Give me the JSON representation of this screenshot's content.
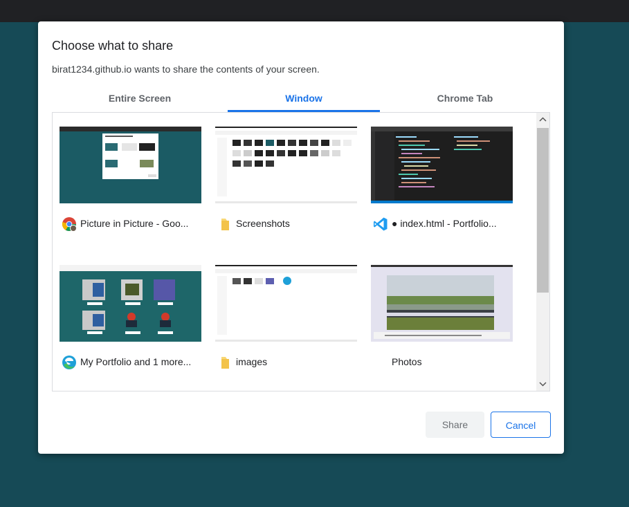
{
  "dialog": {
    "title": "Choose what to share",
    "subtitle": "birat1234.github.io wants to share the contents of your screen."
  },
  "tabs": [
    {
      "label": "Entire Screen",
      "active": false
    },
    {
      "label": "Window",
      "active": true
    },
    {
      "label": "Chrome Tab",
      "active": false
    }
  ],
  "windows": [
    {
      "label": "Picture in Picture - Goo...",
      "icon": "chrome-icon"
    },
    {
      "label": "Screenshots",
      "icon": "folder-icon"
    },
    {
      "label": "● index.html - Portfolio...",
      "icon": "vscode-icon"
    },
    {
      "label": "My Portfolio and 1 more...",
      "icon": "edge-icon"
    },
    {
      "label": "images",
      "icon": "folder-icon"
    },
    {
      "label": "Photos",
      "icon": ""
    }
  ],
  "buttons": {
    "share": "Share",
    "cancel": "Cancel"
  },
  "colors": {
    "accent": "#1a73e8",
    "background": "#164a56"
  }
}
